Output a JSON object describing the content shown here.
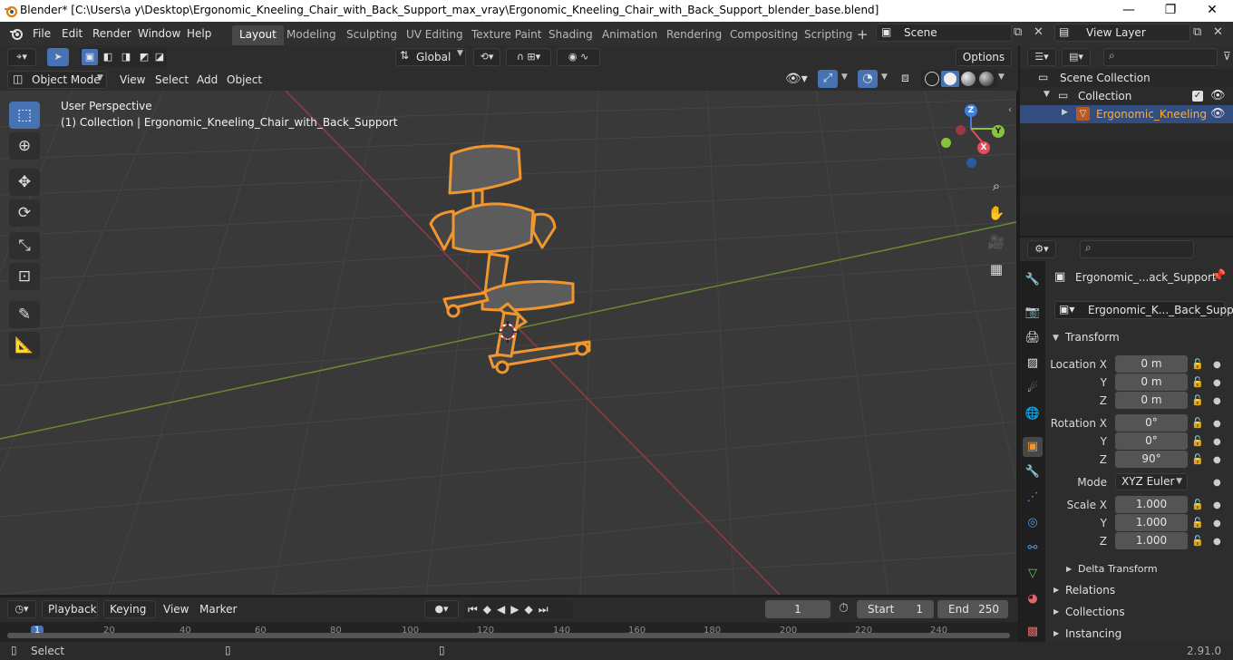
{
  "window": {
    "title": "Blender* [C:\\Users\\a y\\Desktop\\Ergonomic_Kneeling_Chair_with_Back_Support_max_vray\\Ergonomic_Kneeling_Chair_with_Back_Support_blender_base.blend]",
    "min": "—",
    "max": "❐",
    "close": "✕"
  },
  "menu": {
    "items": [
      "File",
      "Edit",
      "Render",
      "Window",
      "Help"
    ]
  },
  "workspaces": [
    "Layout",
    "Modeling",
    "Sculpting",
    "UV Editing",
    "Texture Paint",
    "Shading",
    "Animation",
    "Rendering",
    "Compositing",
    "Scripting"
  ],
  "workspace_add": "+",
  "scene": {
    "name": "Scene"
  },
  "view_layer": {
    "name": "View Layer"
  },
  "toolbar": {
    "transform_orientation": "Global",
    "options": "Options"
  },
  "viewport_header": {
    "mode": "Object Mode",
    "menus": [
      "View",
      "Select",
      "Add",
      "Object"
    ]
  },
  "viewport": {
    "perspective": "User Perspective",
    "collection_info": "(1) Collection | Ergonomic_Kneeling_Chair_with_Back_Support"
  },
  "gizmo": {
    "x": "X",
    "y": "Y",
    "z": "Z"
  },
  "colors": {
    "accent": "#4772b3",
    "selection": "#f0962f",
    "x_axis": "#e84c5a",
    "y_axis": "#88c43a",
    "z_axis": "#3f7fe0",
    "object_select": "#ffaf29"
  },
  "outliner": {
    "search_placeholder": "",
    "rows": [
      {
        "label": "Scene Collection"
      },
      {
        "label": "Collection"
      },
      {
        "label": "Ergonomic_Kneeling"
      }
    ]
  },
  "properties": {
    "search_placeholder": "",
    "object_name": "Ergonomic_...ack_Support",
    "data_name": "Ergonomic_K..._Back_Support",
    "transform_header": "Transform",
    "location": {
      "label": "Location X",
      "y_label": "Y",
      "z_label": "Z",
      "x": "0 m",
      "y": "0 m",
      "z": "0 m"
    },
    "rotation": {
      "label": "Rotation X",
      "y_label": "Y",
      "z_label": "Z",
      "x": "0°",
      "y": "0°",
      "z": "90°"
    },
    "mode": {
      "label": "Mode",
      "value": "XYZ Euler"
    },
    "scale": {
      "label": "Scale X",
      "y_label": "Y",
      "z_label": "Z",
      "x": "1.000",
      "y": "1.000",
      "z": "1.000"
    },
    "delta_transform": "Delta Transform",
    "sections": [
      "Relations",
      "Collections",
      "Instancing"
    ]
  },
  "timeline": {
    "menus": [
      "Playback",
      "Keying",
      "View",
      "Marker"
    ],
    "current_frame": "1",
    "start_label": "Start",
    "start": "1",
    "end_label": "End",
    "end": "250",
    "ticks": [
      "1",
      "20",
      "40",
      "60",
      "80",
      "100",
      "120",
      "140",
      "160",
      "180",
      "200",
      "220",
      "240"
    ]
  },
  "status": {
    "select": "Select",
    "version": "2.91.0"
  }
}
